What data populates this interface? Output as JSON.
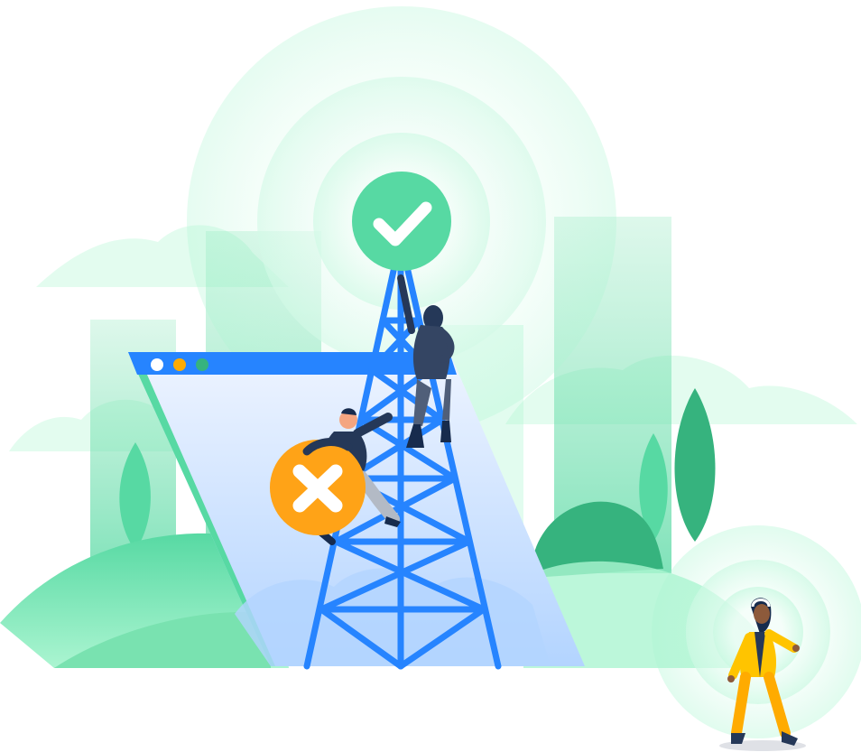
{
  "scene": {
    "description_icons": {
      "status_badge": "checkmark-icon",
      "error_badge": "x-icon",
      "window_dots": [
        "red-dot",
        "yellow-dot",
        "green-dot"
      ]
    },
    "colors": {
      "background": "#ffffff",
      "green_primary": "#57d9a3",
      "green_dark": "#36b37e",
      "green_light": "#abf5d1",
      "green_pale": "#e3fcef",
      "blue_primary": "#2684ff",
      "blue_light": "#b3d4ff",
      "blue_pale": "#deebff",
      "orange": "#ff991f",
      "yellow": "#ffc400",
      "window_dot_red": "#ffffff",
      "window_dot_yellow": "#ffab00",
      "window_dot_green": "#36b37e",
      "person_dark": "#253858"
    }
  }
}
